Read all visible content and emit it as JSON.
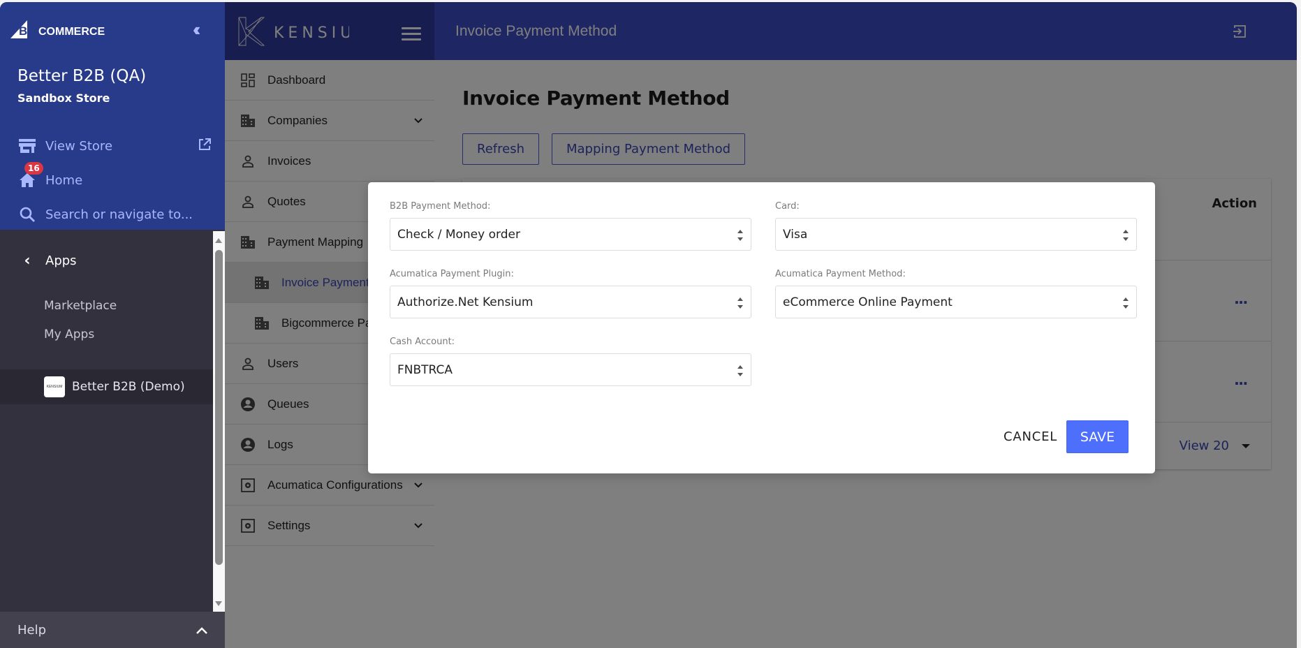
{
  "bigcommerce": {
    "logo_text": "BIGCOMMERCE",
    "store_name": "Better B2B (QA)",
    "store_type": "Sandbox Store",
    "view_store_label": "View Store",
    "home_label": "Home",
    "home_badge": "16",
    "search_placeholder": "Search or navigate to...",
    "apps_label": "Apps",
    "apps_items": [
      "Marketplace",
      "My Apps"
    ],
    "active_app_label": "Better B2B (Demo)",
    "active_app_thumb": "KENSIUM",
    "help_label": "Help",
    "colors": {
      "top": "#283a8a",
      "dark": "#34313f",
      "accent": "#a9b7ff",
      "badge": "#db3643"
    }
  },
  "app": {
    "brand": "KENSIUM",
    "header_title": "Invoice Payment Method",
    "nav": [
      {
        "label": "Dashboard",
        "icon": "dashboard-icon"
      },
      {
        "label": "Companies",
        "icon": "building-icon",
        "expandable": true
      },
      {
        "label": "Invoices",
        "icon": "person-icon"
      },
      {
        "label": "Quotes",
        "icon": "person-icon"
      },
      {
        "label": "Payment Mapping",
        "icon": "building-icon"
      },
      {
        "label": "Invoice Payment Method",
        "icon": "building-icon",
        "sub": true,
        "active": true
      },
      {
        "label": "Bigcommerce Payment Method",
        "icon": "building-icon",
        "sub": true
      },
      {
        "label": "Users",
        "icon": "person-icon"
      },
      {
        "label": "Queues",
        "icon": "account-circle-icon"
      },
      {
        "label": "Logs",
        "icon": "account-circle-icon"
      },
      {
        "label": "Acumatica Configurations",
        "icon": "settings-box-icon",
        "expandable": true
      },
      {
        "label": "Settings",
        "icon": "settings-box-icon",
        "expandable": true
      }
    ],
    "page_title": "Invoice Payment Method",
    "refresh_label": "Refresh",
    "mapping_label": "Mapping Payment Method",
    "table": {
      "action_header": "Action",
      "rows_action": [
        "...",
        "..."
      ],
      "page_size_label": "View 20"
    },
    "colors": {
      "header": "#3d4cc8",
      "nav_header": "#303b9e",
      "link": "#3946b5"
    }
  },
  "modal": {
    "fields": [
      {
        "label": "B2B Payment Method:",
        "value": "Check / Money order"
      },
      {
        "label": "Card:",
        "value": "Visa"
      },
      {
        "label": "Acumatica Payment Plugin:",
        "value": "Authorize.Net Kensium"
      },
      {
        "label": "Acumatica Payment Method:",
        "value": "eCommerce Online Payment"
      },
      {
        "label": "Cash Account:",
        "value": "FNBTRCA"
      }
    ],
    "cancel_label": "CANCEL",
    "save_label": "SAVE",
    "colors": {
      "save": "#4e6ffb"
    }
  }
}
